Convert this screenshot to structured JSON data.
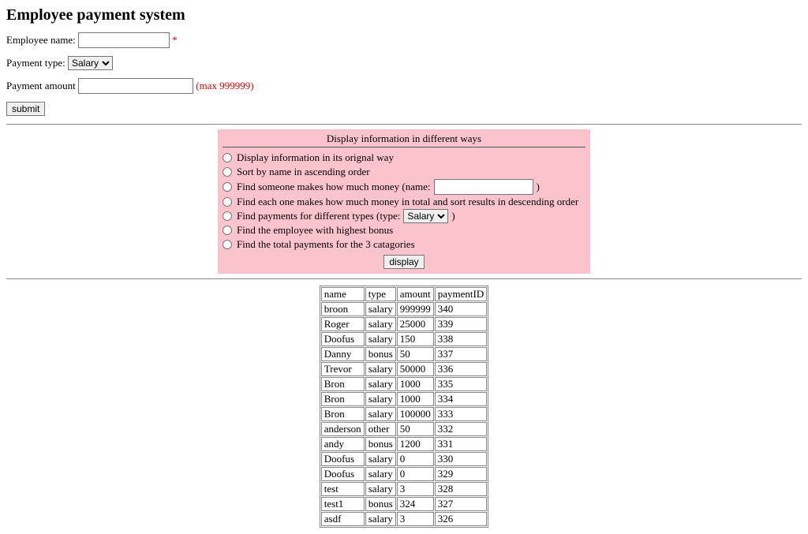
{
  "header": {
    "title": "Employee payment system"
  },
  "form": {
    "name_label": "Employee name:",
    "name_required_marker": "*",
    "type_label": "Payment type:",
    "type_options": [
      "Salary"
    ],
    "type_value": "Salary",
    "amount_label": "Payment amount",
    "amount_hint": "(max 999999)",
    "submit_label": "submit"
  },
  "panel": {
    "title": "Display information in different ways",
    "options": {
      "o1": "Display information in its orignal way",
      "o2": "Sort by name in ascending order",
      "o3_prefix": "Find someone makes how much money (name:",
      "o3_suffix": ")",
      "o4": "Find each one makes how much money in total and sort results in descending order",
      "o5_prefix": "Find payments for different types (type:",
      "o5_suffix": ")",
      "o5_select_value": "Salary",
      "o6": "Find the employee with highest bonus",
      "o7": "Find the total payments for the 3 catagories"
    },
    "display_label": "display"
  },
  "chart_data": {
    "type": "table",
    "columns": [
      "name",
      "type",
      "amount",
      "paymentID"
    ],
    "rows": [
      [
        "broon",
        "salary",
        "999999",
        "340"
      ],
      [
        "Roger",
        "salary",
        "25000",
        "339"
      ],
      [
        "Doofus",
        "salary",
        "150",
        "338"
      ],
      [
        "Danny",
        "bonus",
        "50",
        "337"
      ],
      [
        "Trevor",
        "salary",
        "50000",
        "336"
      ],
      [
        "Bron",
        "salary",
        "1000",
        "335"
      ],
      [
        "Bron",
        "salary",
        "1000",
        "334"
      ],
      [
        "Bron",
        "salary",
        "100000",
        "333"
      ],
      [
        "anderson",
        "other",
        "50",
        "332"
      ],
      [
        "andy",
        "bonus",
        "1200",
        "331"
      ],
      [
        "Doofus",
        "salary",
        "0",
        "330"
      ],
      [
        "Doofus",
        "salary",
        "0",
        "329"
      ],
      [
        "test",
        "salary",
        "3",
        "328"
      ],
      [
        "test1",
        "bonus",
        "324",
        "327"
      ],
      [
        "asdf",
        "salary",
        "3",
        "326"
      ]
    ]
  }
}
